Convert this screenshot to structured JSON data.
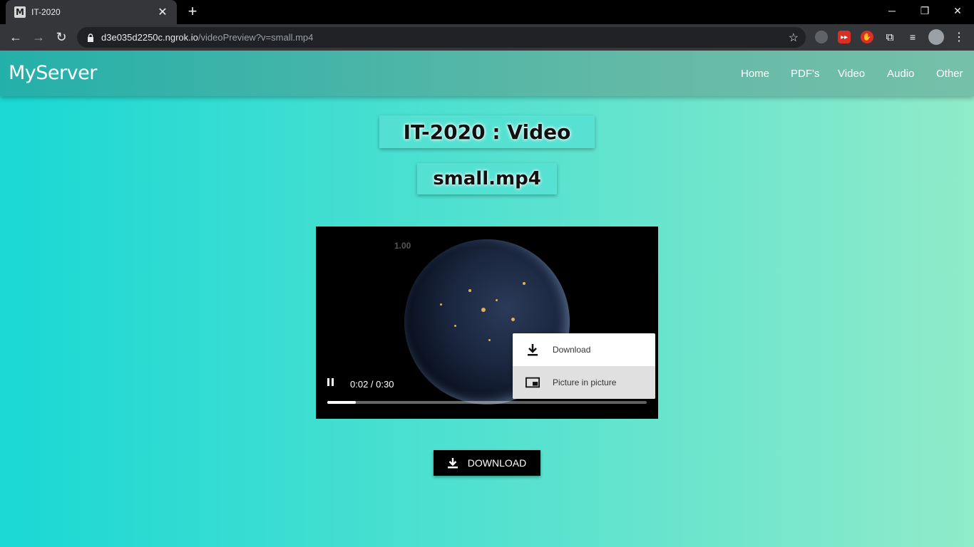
{
  "browser": {
    "tab_title": "IT-2020",
    "favicon_letter": "M",
    "url_host": "d3e035d2250c.ngrok.io",
    "url_path": "/videoPreview?v=small.mp4"
  },
  "navbar": {
    "brand": "MyServer",
    "links": [
      "Home",
      "PDF's",
      "Video",
      "Audio",
      "Other"
    ]
  },
  "main": {
    "heading": "IT-2020 : Video",
    "filename": "small.mp4"
  },
  "video": {
    "fps_overlay": "1.00",
    "time": "0:02 / 0:30",
    "progress": 0.09
  },
  "context_menu": {
    "items": [
      "Download",
      "Picture in picture"
    ]
  },
  "download_button": {
    "label": "DOWNLOAD"
  },
  "colors": {
    "page_gradient_start": "#1ad8d4",
    "page_gradient_end": "#90ebc9",
    "navbar": "#24b0aa"
  }
}
